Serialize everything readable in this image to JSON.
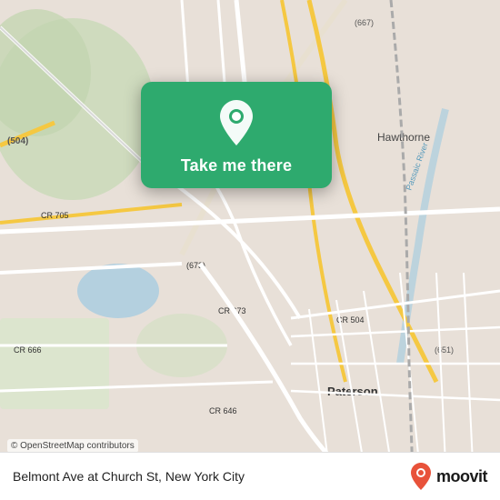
{
  "map": {
    "background_color": "#e8e0d8",
    "center_lat": 40.93,
    "center_lon": -74.17
  },
  "card": {
    "label": "Take me there",
    "background_color": "#2eaa6e",
    "pin_icon": "location-pin-icon"
  },
  "bottom_bar": {
    "location_text": "Belmont Ave at Church St, New York City",
    "attribution_text": "© OpenStreetMap contributors",
    "logo_text": "moovit"
  }
}
